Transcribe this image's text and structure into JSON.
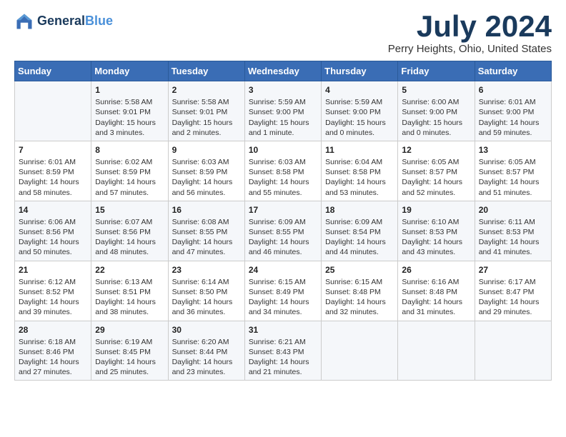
{
  "header": {
    "logo_line1": "General",
    "logo_line2": "Blue",
    "month": "July 2024",
    "location": "Perry Heights, Ohio, United States"
  },
  "weekdays": [
    "Sunday",
    "Monday",
    "Tuesday",
    "Wednesday",
    "Thursday",
    "Friday",
    "Saturday"
  ],
  "weeks": [
    [
      {
        "day": "",
        "info": ""
      },
      {
        "day": "1",
        "info": "Sunrise: 5:58 AM\nSunset: 9:01 PM\nDaylight: 15 hours\nand 3 minutes."
      },
      {
        "day": "2",
        "info": "Sunrise: 5:58 AM\nSunset: 9:01 PM\nDaylight: 15 hours\nand 2 minutes."
      },
      {
        "day": "3",
        "info": "Sunrise: 5:59 AM\nSunset: 9:00 PM\nDaylight: 15 hours\nand 1 minute."
      },
      {
        "day": "4",
        "info": "Sunrise: 5:59 AM\nSunset: 9:00 PM\nDaylight: 15 hours\nand 0 minutes."
      },
      {
        "day": "5",
        "info": "Sunrise: 6:00 AM\nSunset: 9:00 PM\nDaylight: 15 hours\nand 0 minutes."
      },
      {
        "day": "6",
        "info": "Sunrise: 6:01 AM\nSunset: 9:00 PM\nDaylight: 14 hours\nand 59 minutes."
      }
    ],
    [
      {
        "day": "7",
        "info": "Sunrise: 6:01 AM\nSunset: 8:59 PM\nDaylight: 14 hours\nand 58 minutes."
      },
      {
        "day": "8",
        "info": "Sunrise: 6:02 AM\nSunset: 8:59 PM\nDaylight: 14 hours\nand 57 minutes."
      },
      {
        "day": "9",
        "info": "Sunrise: 6:03 AM\nSunset: 8:59 PM\nDaylight: 14 hours\nand 56 minutes."
      },
      {
        "day": "10",
        "info": "Sunrise: 6:03 AM\nSunset: 8:58 PM\nDaylight: 14 hours\nand 55 minutes."
      },
      {
        "day": "11",
        "info": "Sunrise: 6:04 AM\nSunset: 8:58 PM\nDaylight: 14 hours\nand 53 minutes."
      },
      {
        "day": "12",
        "info": "Sunrise: 6:05 AM\nSunset: 8:57 PM\nDaylight: 14 hours\nand 52 minutes."
      },
      {
        "day": "13",
        "info": "Sunrise: 6:05 AM\nSunset: 8:57 PM\nDaylight: 14 hours\nand 51 minutes."
      }
    ],
    [
      {
        "day": "14",
        "info": "Sunrise: 6:06 AM\nSunset: 8:56 PM\nDaylight: 14 hours\nand 50 minutes."
      },
      {
        "day": "15",
        "info": "Sunrise: 6:07 AM\nSunset: 8:56 PM\nDaylight: 14 hours\nand 48 minutes."
      },
      {
        "day": "16",
        "info": "Sunrise: 6:08 AM\nSunset: 8:55 PM\nDaylight: 14 hours\nand 47 minutes."
      },
      {
        "day": "17",
        "info": "Sunrise: 6:09 AM\nSunset: 8:55 PM\nDaylight: 14 hours\nand 46 minutes."
      },
      {
        "day": "18",
        "info": "Sunrise: 6:09 AM\nSunset: 8:54 PM\nDaylight: 14 hours\nand 44 minutes."
      },
      {
        "day": "19",
        "info": "Sunrise: 6:10 AM\nSunset: 8:53 PM\nDaylight: 14 hours\nand 43 minutes."
      },
      {
        "day": "20",
        "info": "Sunrise: 6:11 AM\nSunset: 8:53 PM\nDaylight: 14 hours\nand 41 minutes."
      }
    ],
    [
      {
        "day": "21",
        "info": "Sunrise: 6:12 AM\nSunset: 8:52 PM\nDaylight: 14 hours\nand 39 minutes."
      },
      {
        "day": "22",
        "info": "Sunrise: 6:13 AM\nSunset: 8:51 PM\nDaylight: 14 hours\nand 38 minutes."
      },
      {
        "day": "23",
        "info": "Sunrise: 6:14 AM\nSunset: 8:50 PM\nDaylight: 14 hours\nand 36 minutes."
      },
      {
        "day": "24",
        "info": "Sunrise: 6:15 AM\nSunset: 8:49 PM\nDaylight: 14 hours\nand 34 minutes."
      },
      {
        "day": "25",
        "info": "Sunrise: 6:15 AM\nSunset: 8:48 PM\nDaylight: 14 hours\nand 32 minutes."
      },
      {
        "day": "26",
        "info": "Sunrise: 6:16 AM\nSunset: 8:48 PM\nDaylight: 14 hours\nand 31 minutes."
      },
      {
        "day": "27",
        "info": "Sunrise: 6:17 AM\nSunset: 8:47 PM\nDaylight: 14 hours\nand 29 minutes."
      }
    ],
    [
      {
        "day": "28",
        "info": "Sunrise: 6:18 AM\nSunset: 8:46 PM\nDaylight: 14 hours\nand 27 minutes."
      },
      {
        "day": "29",
        "info": "Sunrise: 6:19 AM\nSunset: 8:45 PM\nDaylight: 14 hours\nand 25 minutes."
      },
      {
        "day": "30",
        "info": "Sunrise: 6:20 AM\nSunset: 8:44 PM\nDaylight: 14 hours\nand 23 minutes."
      },
      {
        "day": "31",
        "info": "Sunrise: 6:21 AM\nSunset: 8:43 PM\nDaylight: 14 hours\nand 21 minutes."
      },
      {
        "day": "",
        "info": ""
      },
      {
        "day": "",
        "info": ""
      },
      {
        "day": "",
        "info": ""
      }
    ]
  ]
}
